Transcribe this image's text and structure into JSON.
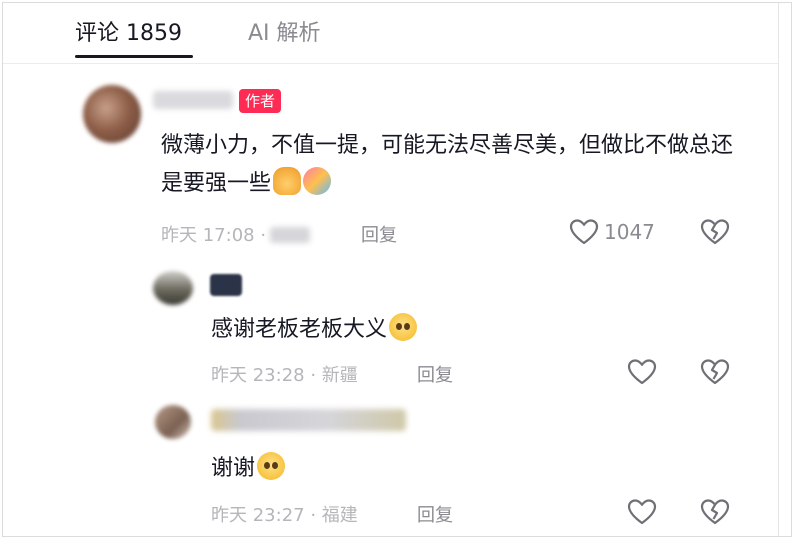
{
  "tabs": [
    {
      "label": "评论 1859"
    },
    {
      "label": "AI 解析"
    }
  ],
  "comments": [
    {
      "badge": "作者",
      "text": "微薄小力，不值一提，可能无法尽善尽美，但做比不做总还是要强一些",
      "emojis": [
        "pray-icon",
        "hug-icon"
      ],
      "time": "昨天 17:08 ·",
      "reply": "回复",
      "likes": "1047"
    },
    {
      "text": "感谢老板老板大义",
      "emojis": [
        "moved-face-icon"
      ],
      "time": "昨天 23:28 · 新疆",
      "reply": "回复",
      "likes": ""
    },
    {
      "text": "谢谢",
      "emojis": [
        "moved-face-icon"
      ],
      "time": "昨天 23:27 · 福建",
      "reply": "回复",
      "likes": ""
    }
  ],
  "colors": {
    "badge": "#fe2c55",
    "primary_text": "#161823",
    "secondary_text": "#8a8b91",
    "meta_text": "#b5b6ba"
  }
}
